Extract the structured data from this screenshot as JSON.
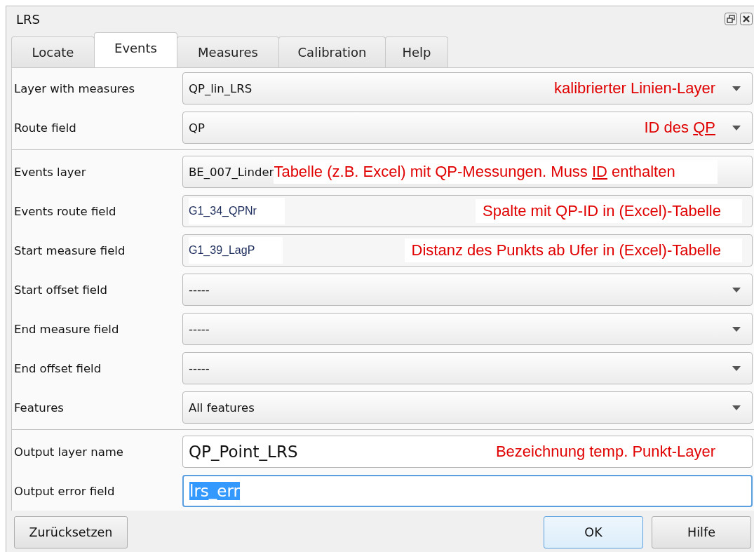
{
  "window": {
    "title": "LRS"
  },
  "tabs": [
    {
      "label": "Locate",
      "selected": false
    },
    {
      "label": "Events",
      "selected": true
    },
    {
      "label": "Measures",
      "selected": false
    },
    {
      "label": "Calibration",
      "selected": false
    },
    {
      "label": "Help",
      "selected": false
    }
  ],
  "groups": [
    [
      {
        "label": "Layer with measures",
        "kind": "combo",
        "value": "QP_lin_LRS",
        "note": {
          "before": "kalibrierter Linien-Layer"
        }
      },
      {
        "label": "Route field",
        "kind": "combo",
        "value": "QP",
        "note": {
          "before": "ID des ",
          "underlined": "QP"
        }
      }
    ],
    [
      {
        "label": "Events layer",
        "kind": "combo-covered",
        "value": "BE_007_Linder",
        "note": {
          "before": "Tabelle (z.B. Excel) mit QP-Messungen. Muss ",
          "underlined": "ID",
          "after": " enthalten"
        }
      },
      {
        "label": "Events route field",
        "kind": "patched",
        "value": "G1_34_QPNr",
        "note": {
          "before": "Spalte mit QP-ID in (Excel)-Tabelle"
        }
      },
      {
        "label": "Start measure field",
        "kind": "patched",
        "value": "G1_39_LagP",
        "note": {
          "before": "Distanz des Punkts ab Ufer in (Excel)-Tabelle"
        }
      },
      {
        "label": "Start offset field",
        "kind": "combo",
        "value": "-----"
      },
      {
        "label": "End measure field",
        "kind": "combo",
        "value": "-----"
      },
      {
        "label": "End offset field",
        "kind": "combo",
        "value": "-----"
      },
      {
        "label": "Features",
        "kind": "combo",
        "value": "All features"
      }
    ],
    [
      {
        "label": "Output layer name",
        "kind": "text",
        "value": "QP_Point_LRS",
        "focused": false,
        "text_selected": false,
        "note": {
          "before": "Bezeichnung temp. Punkt-Layer"
        }
      },
      {
        "label": "Output error field",
        "kind": "text",
        "value": "lrs_err",
        "focused": true,
        "text_selected": true
      }
    ]
  ],
  "left_buttons": [
    {
      "label": "Zurücksetzen",
      "default": false
    }
  ],
  "right_buttons": [
    {
      "label": "OK",
      "default": true
    },
    {
      "label": "Hilfe",
      "default": false
    }
  ]
}
